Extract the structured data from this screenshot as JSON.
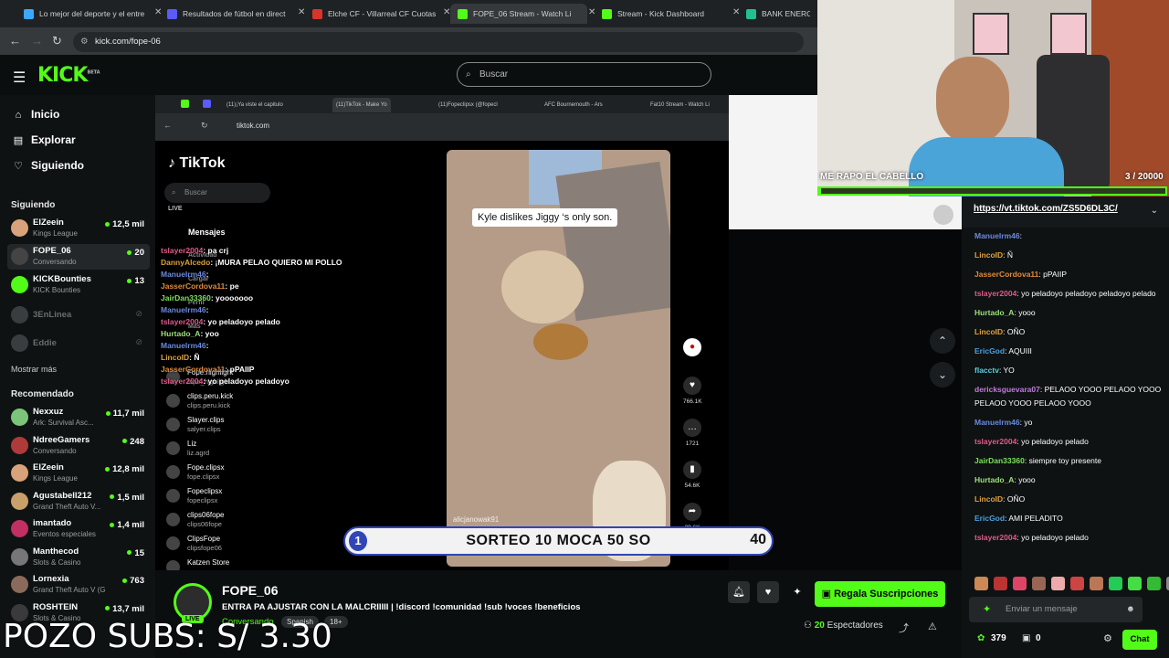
{
  "browser_tabs": [
    {
      "title": "Lo mejor del deporte y el entre",
      "color": "#3aa8ff"
    },
    {
      "title": "Resultados de fútbol en direct",
      "color": "#5b5bff"
    },
    {
      "title": "Elche CF - Villarreal CF Cuotas",
      "color": "#d9342b"
    },
    {
      "title": "FOPE_06 Stream - Watch Li",
      "color": "#53fc18"
    },
    {
      "title": "Stream - Kick Dashboard",
      "color": "#53fc18"
    },
    {
      "title": "BANK ENERO",
      "color": "#21c28e"
    }
  ],
  "url": "kick.com/fope-06",
  "search_placeholder": "Buscar",
  "nav": {
    "inicio": "Inicio",
    "explorar": "Explorar",
    "siguiendo": "Siguiendo"
  },
  "following_header": "Siguiendo",
  "following": [
    {
      "name": "ElZeein",
      "category": "Kings League",
      "viewers": "12,5 mil",
      "color": "#d8a27a"
    },
    {
      "name": "FOPE_06",
      "category": "Conversando",
      "viewers": "20",
      "color": "#444"
    },
    {
      "name": "KICKBounties",
      "category": "KICK Bounties",
      "viewers": "13",
      "color": "#53fc18"
    }
  ],
  "offline": [
    "3EnLinea",
    "Eddie"
  ],
  "show_more": "Mostrar más",
  "recommended_header": "Recomendado",
  "recommended": [
    {
      "name": "Nexxuz",
      "category": "Ark: Survival Asc...",
      "viewers": "11,7 mil",
      "color": "#7bc57b"
    },
    {
      "name": "NdreeGamers",
      "category": "Conversando",
      "viewers": "248",
      "color": "#b03a3a"
    },
    {
      "name": "ElZeein",
      "category": "Kings League",
      "viewers": "12,8 mil",
      "color": "#d8a27a"
    },
    {
      "name": "Agustabell212",
      "category": "Grand Theft Auto V...",
      "viewers": "1,5 mil",
      "color": "#c9a06a"
    },
    {
      "name": "imantado",
      "category": "Eventos especiales",
      "viewers": "1,4 mil",
      "color": "#c03060"
    },
    {
      "name": "Manthecod",
      "category": "Slots & Casino",
      "viewers": "15",
      "color": "#777"
    },
    {
      "name": "Lornexia",
      "category": "Grand Theft Auto V (G...",
      "viewers": "763",
      "color": "#8a6a5a"
    },
    {
      "name": "ROSHTEIN",
      "category": "Slots & Casino",
      "viewers": "13,7 mil",
      "color": "#3a3a3a"
    }
  ],
  "inner_browser": {
    "tabs": [
      "(11)¡Ya viste el capitulo",
      "(11)TikTok - Make Yo",
      "(11)Fopeclipsx (@fopecl",
      "AFC Bournemouth - Ars",
      "Fat10 Stream - Watch Li"
    ],
    "url": "tiktok.com",
    "tiktok_logo": "TikTok",
    "tiktok_search": "Buscar",
    "menu": [
      "LIVE",
      "Mensajes",
      "Actividad",
      "Cargar",
      "Perfil",
      "Más"
    ],
    "accounts": [
      {
        "name": "Fope.highlight",
        "handle": "fope_highlight"
      },
      {
        "name": "clips.peru.kick",
        "handle": "clips.peru.kick"
      },
      {
        "name": "Slayer.clips",
        "handle": "salyer.clips"
      },
      {
        "name": "Liz",
        "handle": "liz.agrd"
      },
      {
        "name": "Fope.clipsx",
        "handle": "fope.clipsx"
      },
      {
        "name": "Fopeclipsx",
        "handle": "fopeclipsx"
      },
      {
        "name": "clips06fope",
        "handle": "clips06fope"
      },
      {
        "name": "ClipsFope",
        "handle": "clipsfope06"
      },
      {
        "name": "Katzen Store",
        "handle": ""
      }
    ],
    "overlay_chat": [
      {
        "user": "tslayer2004",
        "text": "pa crj",
        "color": "#e05a8c"
      },
      {
        "user": "DannyAlcedo",
        "text": "¡MURA PELAO QUIERO MI POLLO",
        "color": "#d9a23a"
      },
      {
        "user": "Manuelrm46",
        "text": "",
        "color": "#6a8ae0"
      },
      {
        "user": "JasserCordova11",
        "text": "pe",
        "color": "#e08a3a"
      },
      {
        "user": "JairDan33360",
        "text": "yooooooo",
        "color": "#7be05a"
      },
      {
        "user": "Manuelrm46",
        "text": "",
        "color": "#6a8ae0"
      },
      {
        "user": "tslayer2004",
        "text": "yo peladoyo pelado",
        "color": "#e05a8c"
      },
      {
        "user": "Hurtado_A",
        "text": "yoo",
        "color": "#9be07a"
      },
      {
        "user": "Manuelrm46",
        "text": "",
        "color": "#6a8ae0"
      },
      {
        "user": "LincoID",
        "text": "Ñ",
        "color": "#e0a03a"
      },
      {
        "user": "JasserCordova11",
        "text": "pPAIIP",
        "color": "#e08a3a"
      },
      {
        "user": "tslayer2004",
        "text": "yo peladoyo peladoyo",
        "color": "#e05a8c"
      }
    ],
    "video_caption": "Kyle dislikes Jiggy  ‘s only son.",
    "video_author": "alicjanowak91",
    "actions": [
      {
        "icon": "♥",
        "count": "766.1K"
      },
      {
        "icon": "…",
        "count": "1721"
      },
      {
        "icon": "▮",
        "count": "54.6K"
      },
      {
        "icon": "➦",
        "count": "29.6K"
      }
    ]
  },
  "raffle": {
    "number": "1",
    "text": "SORTEO 10 MOCA 50 SO",
    "count": "40"
  },
  "webcam": {
    "title": "ME RAPO EL CABELLO",
    "count": "3 / 20000",
    "progress": 0.00015
  },
  "stream": {
    "name": "FOPE_06",
    "title": "ENTRA PA AJUSTAR CON LA MALCRIIIII | !discord !comunidad !sub !voces !beneficios",
    "category": "Conversando",
    "tags": [
      "Spanish",
      "18+"
    ],
    "live": "LIVE",
    "subscribe": "Regala Suscripciones",
    "viewers": "20",
    "viewers_label": "Espectadores"
  },
  "overlay_text": "POZO SUBS: S/ 3.30",
  "chat": {
    "pinned": "https://vt.tiktok.com/ZS5D6DL3C/",
    "messages": [
      {
        "user": "Manuelrm46",
        "text": "",
        "color": "#6a8ae0"
      },
      {
        "user": "LincoID",
        "text": "Ñ",
        "color": "#e0a03a"
      },
      {
        "user": "JasserCordova11",
        "text": "pPAIIP",
        "color": "#e08a3a"
      },
      {
        "user": "tslayer2004",
        "text": "yo peladoyo peladoyo peladoyo pelado",
        "color": "#e05a8c"
      },
      {
        "user": "Hurtado_A",
        "text": "yooo",
        "color": "#9be07a"
      },
      {
        "user": "LincoID",
        "text": "OÑO",
        "color": "#e0a03a"
      },
      {
        "user": "EricGod",
        "text": "AQUIII",
        "color": "#4aa0e0"
      },
      {
        "user": "flacctv",
        "text": "YO",
        "color": "#5ad0e0"
      },
      {
        "user": "dericksguevara07",
        "text": "PELAOO YOOO PELAOO YOOO PELAOO YOOO PELAOO YOOO",
        "color": "#c07ae0"
      },
      {
        "user": "Manuelrm46",
        "text": "yo",
        "color": "#6a8ae0"
      },
      {
        "user": "tslayer2004",
        "text": "yo peladoyo pelado",
        "color": "#e05a8c"
      },
      {
        "user": "JairDan33360",
        "text": "siempre toy presente",
        "color": "#7be05a"
      },
      {
        "user": "Hurtado_A",
        "text": "yooo",
        "color": "#9be07a"
      },
      {
        "user": "LincoID",
        "text": "OÑO",
        "color": "#e0a03a"
      },
      {
        "user": "EricGod",
        "text": "AMI PELADITO",
        "color": "#4aa0e0"
      },
      {
        "user": "tslayer2004",
        "text": "yo peladoyo pelado",
        "color": "#e05a8c"
      }
    ],
    "input_placeholder": "Enviar un mensaje",
    "points": "379",
    "gifts": "0",
    "send": "Chat"
  }
}
